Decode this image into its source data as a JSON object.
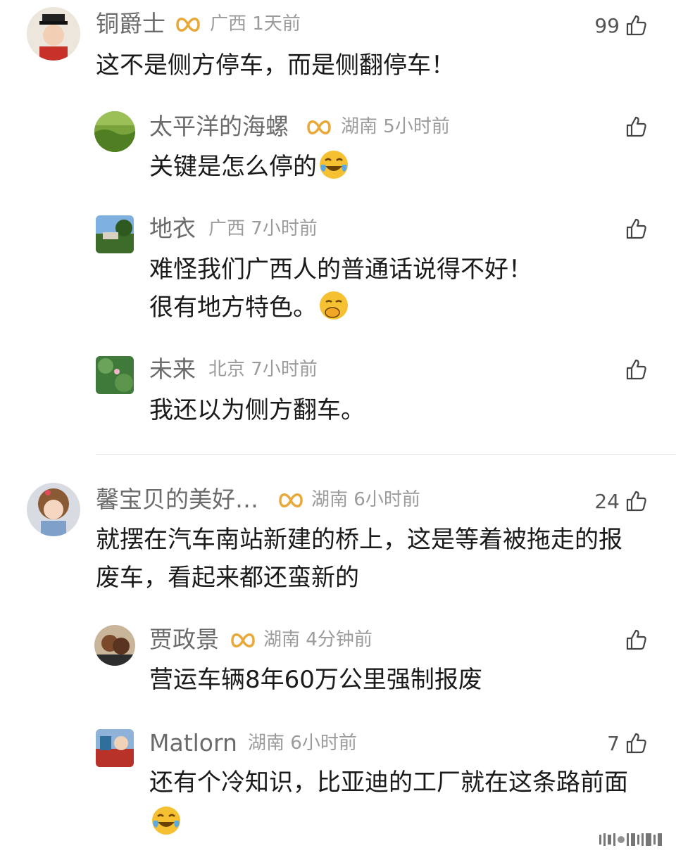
{
  "colors": {
    "name": "#6b6b6b",
    "meta": "#9b9b9b",
    "vip_gold": "#e9a93a",
    "text": "#1a1a1a"
  },
  "comments": [
    {
      "user": "铜爵士",
      "vip": true,
      "location": "广西",
      "time": "1天前",
      "likes": "99",
      "lines": [
        "这不是侧方停车，而是侧翻停车！"
      ]
    },
    {
      "user": "太平洋的海螺",
      "vip": true,
      "location": "湖南",
      "time": "5小时前",
      "likes": "",
      "lines": [
        "关键是怎么停的"
      ],
      "emoji": "laughing-crying-emoji"
    },
    {
      "user": "地衣",
      "vip": false,
      "location": "广西",
      "time": "7小时前",
      "likes": "",
      "lines": [
        "难怪我们广西人的普通话说得不好！",
        "很有地方特色。"
      ],
      "emoji": "giggle-emoji"
    },
    {
      "user": "未来",
      "vip": false,
      "location": "北京",
      "time": "7小时前",
      "likes": "",
      "lines": [
        "我还以为侧方翻车。"
      ]
    },
    {
      "user": "馨宝贝的美好…",
      "vip": true,
      "location": "湖南",
      "time": "6小时前",
      "likes": "24",
      "lines": [
        "就摆在汽车南站新建的桥上，这是等着被拖走的报",
        "废车，看起来都还蛮新的"
      ]
    },
    {
      "user": "贾政景",
      "vip": true,
      "location": "湖南",
      "time": "4分钟前",
      "likes": "",
      "lines": [
        "营运车辆8年60万公里强制报废"
      ]
    },
    {
      "user": "Matlorn",
      "vip": false,
      "location": "湖南",
      "time": "6小时前",
      "likes": "7",
      "lines": [
        "还有个冷知识，比亚迪的工厂就在这条路前面"
      ],
      "emoji": "laughing-crying-emoji"
    }
  ]
}
